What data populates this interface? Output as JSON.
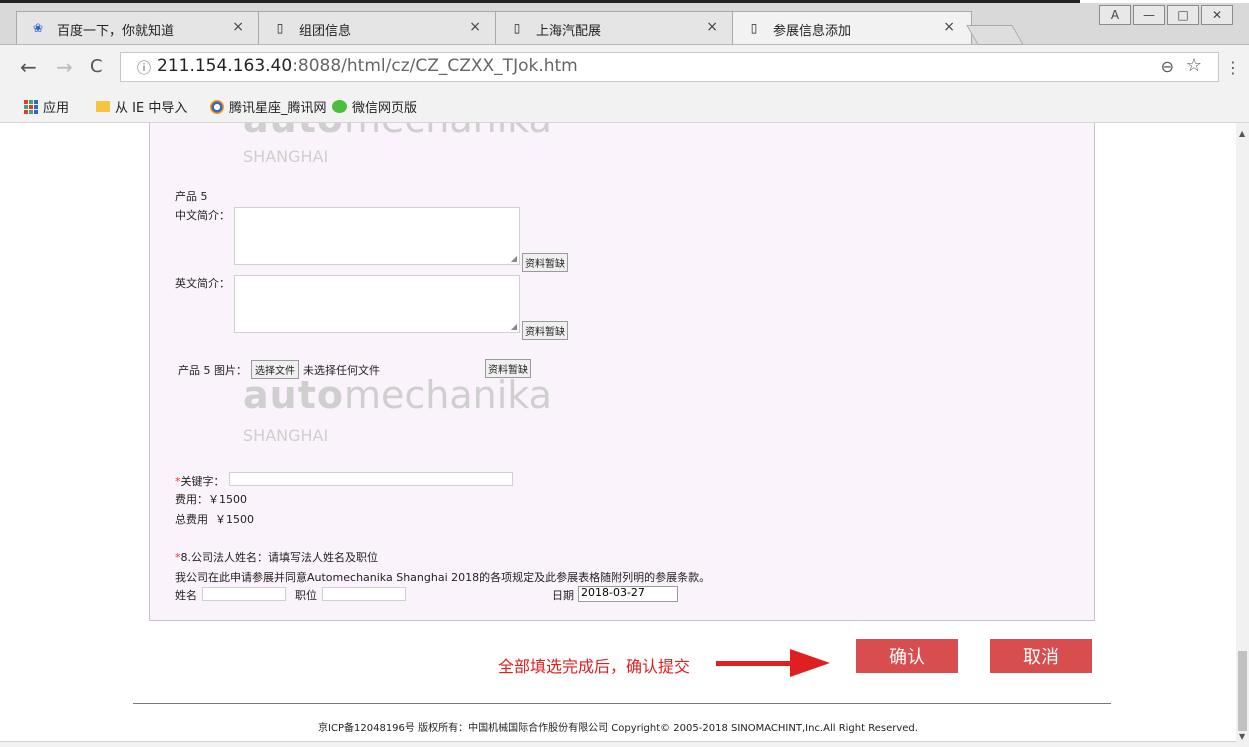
{
  "browser": {
    "tabs": [
      {
        "title": "百度一下，你就知道",
        "icon": "baidu-paw-icon",
        "close": "×"
      },
      {
        "title": "组团信息",
        "icon": "page-icon",
        "close": "×"
      },
      {
        "title": "上海汽配展",
        "icon": "page-icon",
        "close": "×"
      },
      {
        "title": "参展信息添加",
        "icon": "page-icon",
        "close": "×"
      }
    ],
    "window_buttons": [
      "A",
      "—",
      "□",
      "✕"
    ],
    "nav": {
      "back": "←",
      "forward": "→",
      "reload": "C"
    },
    "address": {
      "info": "ⓘ",
      "host": "211.154.163.40",
      "path": ":8088/html/cz/CZ_CZXX_TJok.htm"
    },
    "zoom_icon": "⊖",
    "star_icon": "☆",
    "menu_icon": "⋮",
    "bookmarks": [
      {
        "label": "应用",
        "icon": "apps-grid-icon"
      },
      {
        "label": "从 IE 中导入",
        "icon": "folder-icon"
      },
      {
        "label": "腾讯星座_腾讯网",
        "icon": "qq-icon"
      },
      {
        "label": "微信网页版",
        "icon": "wechat-icon"
      }
    ]
  },
  "watermark": {
    "auto": "auto",
    "mech": "mechanika",
    "city": "SHANGHAI"
  },
  "form": {
    "product_title": "产品 5",
    "cn_intro_label": "中文简介：",
    "en_intro_label": "英文简介：",
    "missing_label": "资料暂缺",
    "image_label": "产品 5 图片：",
    "file_button": "选择文件",
    "no_file": "未选择任何文件",
    "keyword_star": "*",
    "keyword_label": "关键字：",
    "fee": "费用：￥1500",
    "total_fee": "总费用  ￥1500",
    "legal_star": "*",
    "legal_heading": "8.公司法人姓名：请填写法人姓名及职位",
    "agreement": "我公司在此申请参展并同意Automechanika Shanghai 2018的各项规定及此参展表格随附列明的参展条款。",
    "name_label": "姓名",
    "position_label": "职位",
    "date_label": "日期",
    "date_value": "2018-03-27"
  },
  "actions": {
    "hint": "全部填选完成后，确认提交",
    "confirm": "确认",
    "cancel": "取消"
  },
  "footer": "京ICP备12048196号 版权所有：中国机械国际合作股份有限公司 Copyright© 2005-2018 SINOMACHINT,Inc.All Right Reserved.",
  "colors": {
    "accent_red": "#d84e4e",
    "hint_red": "#e02020",
    "panel_bg": "#fbf3fb"
  }
}
